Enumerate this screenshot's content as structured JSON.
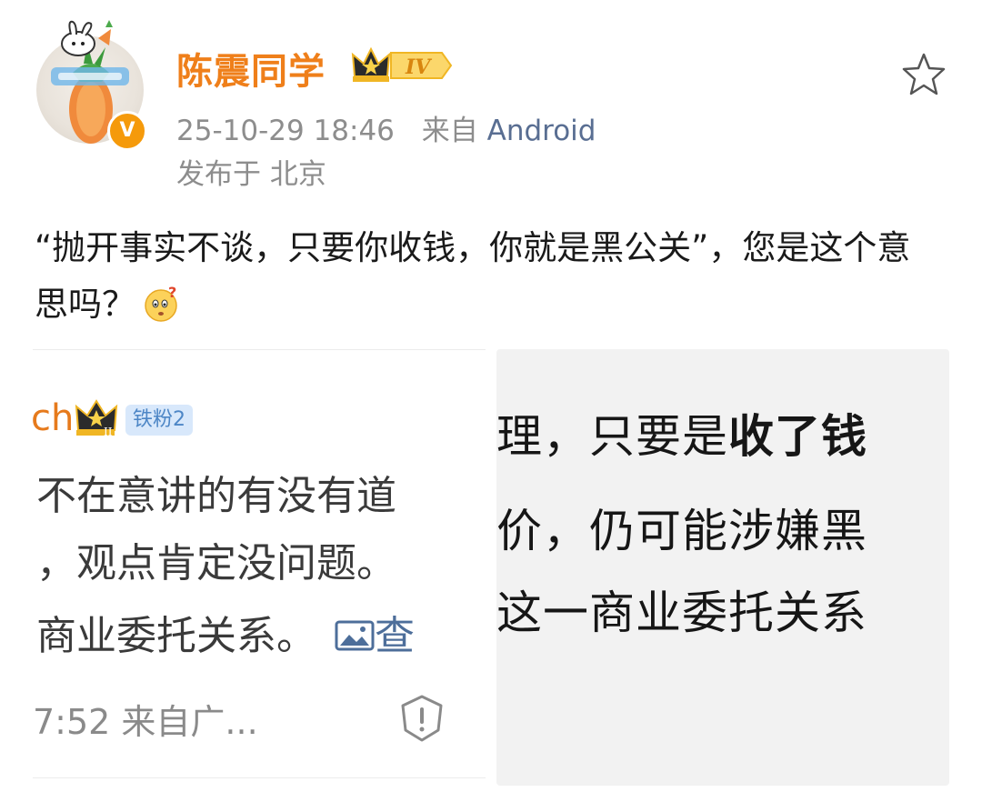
{
  "post": {
    "username": "陈震同学",
    "level_badge": "IV",
    "timestamp": "25-10-29 18:46",
    "source_prefix": "来自",
    "source": "Android",
    "location": "发布于 北京",
    "text": "“抛开事实不谈，只要你收钱，你就是黑公关”，您是这个意思吗？"
  },
  "image1": {
    "username_fragment": "ch",
    "fan_badge": "铁粉2",
    "crown_level": "II",
    "line1": "不在意讲的有没有道",
    "line2": "，观点肯定没问题。",
    "line3": "商业委托关系。",
    "link_fragment": "查",
    "footer": "7:52 来自广..."
  },
  "image2": {
    "line1_a": "理，只要是",
    "line1_b": "收了钱",
    "line2": "价，仍可能涉嫌黑",
    "line3": "这一商业委托关系"
  },
  "colors": {
    "username": "#ef7f1a",
    "meta": "#8d8d8d",
    "source_link": "#596e92",
    "verified": "#f59a0b"
  },
  "icons": {
    "star": "star-outline-icon",
    "verified": "verified-v-icon",
    "emoji": "confused-emoji-icon",
    "shield": "shield-alert-icon",
    "image": "image-icon"
  }
}
